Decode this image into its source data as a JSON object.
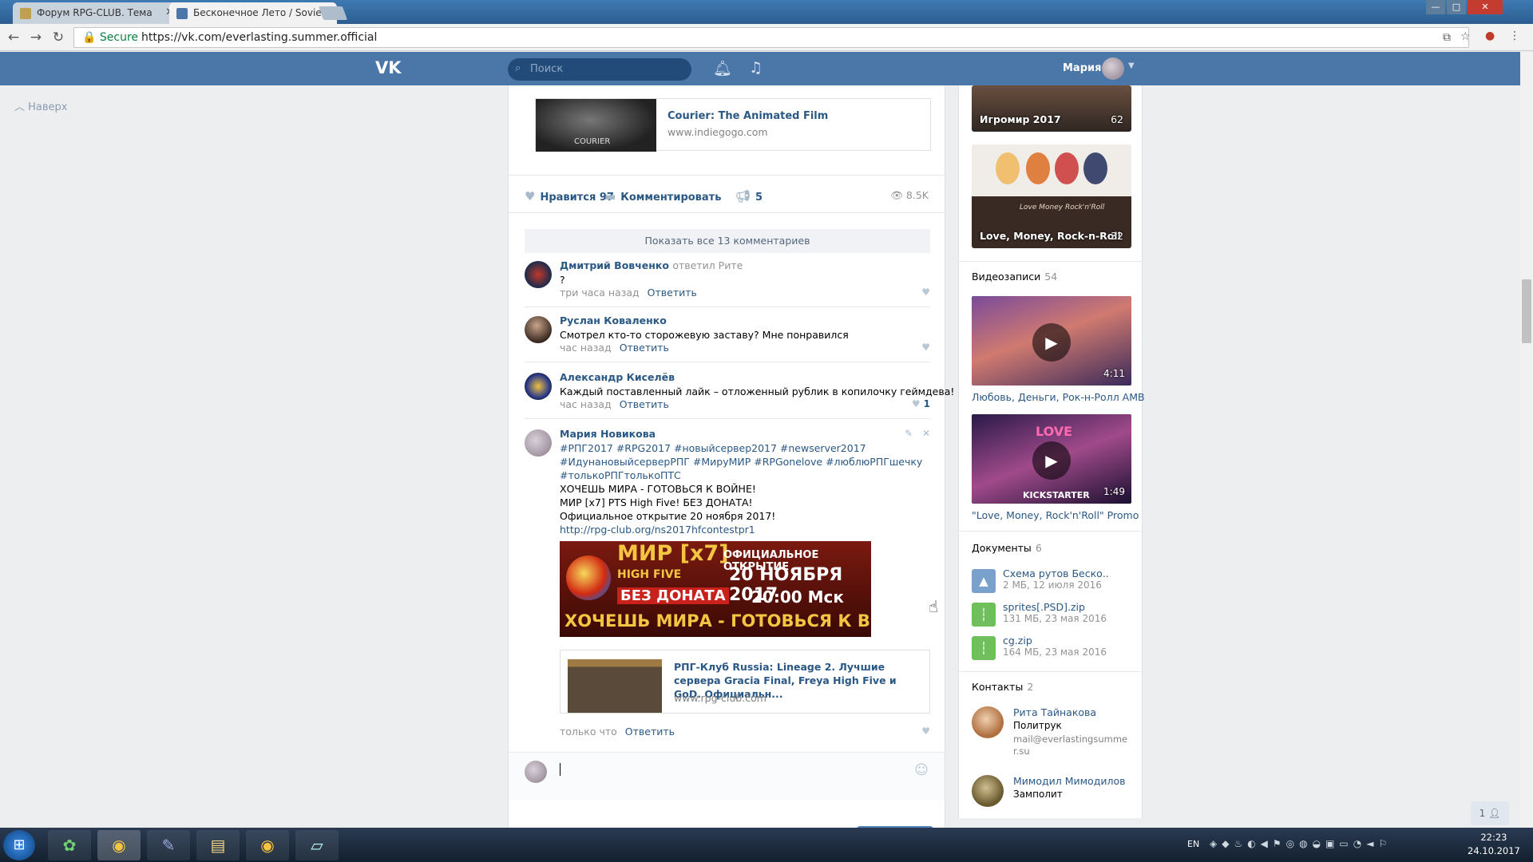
{
  "browser": {
    "tabs": [
      {
        "title": "Форум RPG-CLUB. Тема",
        "favicon_color": "#c0a050",
        "active": false
      },
      {
        "title": "Бесконечное Лето / Soviet",
        "favicon_color": "#4a76a8",
        "active": true
      }
    ],
    "secure_label": "Secure",
    "url": "https://vk.com/everlasting.summer.official",
    "window_buttons": [
      "—",
      "□",
      "✕"
    ]
  },
  "vk": {
    "logo": "VK",
    "search_placeholder": "Поиск",
    "username": "Мария",
    "to_top": "Наверх"
  },
  "post": {
    "link_card": {
      "title": "Courier: The Animated Film",
      "domain": "www.indiegogo.com",
      "thumb_text": "COURIER"
    },
    "likes_label": "Нравится",
    "likes_count": "97",
    "comment_label": "Комментировать",
    "shares_count": "5",
    "views": "8.5K",
    "show_all": "Показать все 13 комментариев"
  },
  "comments": [
    {
      "author": "Дмитрий Вовченко",
      "reply_to": "ответил Рите",
      "text": "?",
      "time": "три часа назад",
      "reply": "Ответить",
      "likes": ""
    },
    {
      "author": "Руслан Коваленко",
      "reply_to": "",
      "text": "Смотрел кто-то сторожевую заставу? Мне понравился",
      "time": "час назад",
      "reply": "Ответить",
      "likes": ""
    },
    {
      "author": "Александр Киселёв",
      "reply_to": "",
      "text": "Каждый поставленный лайк – отложенный рублик в копилочку геймдева!",
      "time": "час назад",
      "reply": "Ответить",
      "likes": "1"
    },
    {
      "author": "Мария Новикова",
      "lines": [
        "#РПГ2017 #RPG2017 #новыйсервер2017 #newserver2017",
        "#ИдунановыйсерверРПГ #МируМИР #RPGonelove #люблюРПГшечку",
        "#толькоРПГтолькоПТС",
        "ХОЧЕШЬ МИРА - ГОТОВЬСЯ К ВОЙНЕ!",
        "МИР [x7] PTS High Five! БЕЗ ДОНАТА!",
        "Официальное открытие 20 ноября 2017!",
        "http://rpg-club.org/ns2017hfcontestpr1"
      ],
      "banner": {
        "l1": "МИР [x7]",
        "l2": "ОФИЦИАЛЬНОЕ ОТКРЫТИЕ",
        "l3": "HIGH FIVE",
        "l4": "20 НОЯБРЯ 2017",
        "l5": "БЕЗ ДОНАТА",
        "l6": "20:00 Мск",
        "l7": "ХОЧЕШЬ МИРА - ГОТОВЬСЯ К ВОЙНЕ"
      },
      "share": {
        "title": "РПГ-Клуб Russia: Lineage 2. Лучшие сервера Gracia Final, Freya High Five и GoD. Официальн...",
        "domain": "www.rpg-club.com"
      },
      "time": "только что",
      "reply": "Ответить"
    }
  ],
  "sidebar": {
    "albums": [
      {
        "name": "Игромир 2017",
        "count": "62"
      },
      {
        "name": "Love, Money, Rock-n-Roll",
        "count": "32",
        "banner": "Love Money Rock'n'Roll"
      }
    ],
    "videos_header": "Видеозаписи",
    "videos_count": "54",
    "videos": [
      {
        "title": "Любовь, Деньги, Рок-н-Ролл AMB",
        "duration": "4:11"
      },
      {
        "title": "\"Love, Money, Rock'n'Roll\" Promo",
        "duration": "1:49",
        "overlay": "KICKSTARTER",
        "logo": "LOVE"
      }
    ],
    "docs_header": "Документы",
    "docs_count": "6",
    "docs": [
      {
        "name": "Схема рутов Беско..",
        "meta": "2 МБ, 12 июля 2016",
        "color": "#7aa0cc",
        "icon": "image-icon"
      },
      {
        "name": "sprites[.PSD].zip",
        "meta": "131 МБ, 23 мая 2016",
        "color": "#6fbf5d",
        "icon": "archive-icon"
      },
      {
        "name": "cg.zip",
        "meta": "164 МБ, 23 мая 2016",
        "color": "#6fbf5d",
        "icon": "archive-icon"
      }
    ],
    "contacts_header": "Контакты",
    "contacts_count": "2",
    "contacts": [
      {
        "name": "Рита Тайнакова",
        "role": "Политрук",
        "email": "mail@everlastingsummer.su"
      },
      {
        "name": "Мимодил Мимодилов",
        "role": "Замполит",
        "email": ""
      }
    ]
  },
  "chat_button": "1",
  "taskbar": {
    "lang": "EN",
    "time": "22:23",
    "date": "24.10.2017"
  }
}
